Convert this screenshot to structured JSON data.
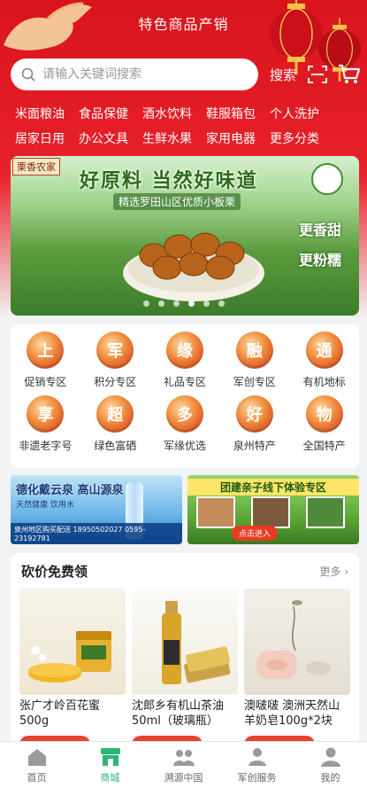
{
  "header": {
    "title": "特色商品产销",
    "search_placeholder": "请输入关键词搜索",
    "search_button": "搜索"
  },
  "categories": [
    [
      "米面粮油",
      "食品保健",
      "酒水饮料",
      "鞋服箱包",
      "个人洗护"
    ],
    [
      "居家日用",
      "办公文具",
      "生鲜水果",
      "家用电器",
      "更多分类"
    ]
  ],
  "banner": {
    "brand": "栗香农家",
    "headline": "好原料 当然好味道",
    "subline": "精选罗田山区优质小板栗",
    "tag1": "更香甜",
    "tag2": "更粉糯",
    "dots": 6,
    "active_dot": 3
  },
  "icons": [
    {
      "label": "促销专区",
      "glyph": "上"
    },
    {
      "label": "积分专区",
      "glyph": "军"
    },
    {
      "label": "礼品专区",
      "glyph": "缘"
    },
    {
      "label": "军创专区",
      "glyph": "融"
    },
    {
      "label": "有机地标",
      "glyph": "通"
    },
    {
      "label": "非遗老字号",
      "glyph": "享"
    },
    {
      "label": "绿色富硒",
      "glyph": "超"
    },
    {
      "label": "军缘优选",
      "glyph": "多"
    },
    {
      "label": "泉州特产",
      "glyph": "好"
    },
    {
      "label": "全国特产",
      "glyph": "物"
    }
  ],
  "promo_left": {
    "title": "德化戴云泉 高山源泉",
    "sub": "天然健康 饮用水",
    "region": "泉州地区购买配送",
    "phone": "18950502027 0595-23192781"
  },
  "promo_right": {
    "title": "团建亲子线下体验专区",
    "button": "点击进入"
  },
  "bargain": {
    "title": "砍价免费领",
    "more": "更多",
    "products": [
      {
        "name": "张广才岭百花蜜500g"
      },
      {
        "name": "沈郎乡有机山茶油50ml（玻璃瓶）"
      },
      {
        "name": "澳啵啵 澳洲天然山羊奶皂100g*2块"
      }
    ]
  },
  "tabbar": [
    {
      "label": "首页",
      "icon": "home-icon"
    },
    {
      "label": "商城",
      "icon": "shop-icon",
      "active": true
    },
    {
      "label": "溯源中国",
      "icon": "people-icon"
    },
    {
      "label": "军创服务",
      "icon": "service-icon"
    },
    {
      "label": "我的",
      "icon": "user-icon"
    }
  ],
  "colors": {
    "brand_red": "#e8212a",
    "active_green": "#2bb673"
  }
}
